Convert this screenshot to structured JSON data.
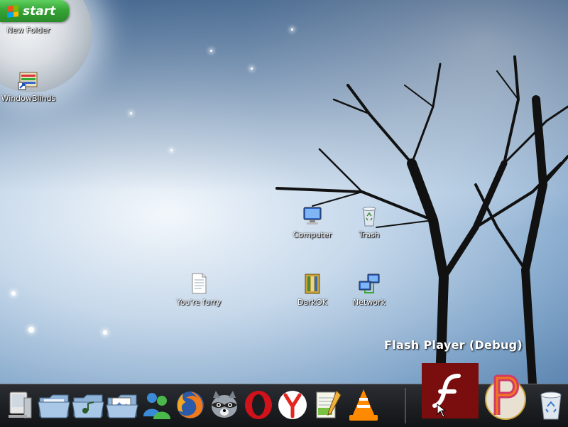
{
  "start": {
    "label": "start"
  },
  "desktop_icons": [
    {
      "id": "new-folder",
      "label": "New Folder"
    },
    {
      "id": "windowblinds",
      "label": "WindowBlinds"
    },
    {
      "id": "computer",
      "label": "Computer"
    },
    {
      "id": "trash",
      "label": "Trash"
    },
    {
      "id": "youre-furry",
      "label": "You're furry"
    },
    {
      "id": "darkok",
      "label": "DarkOK"
    },
    {
      "id": "network",
      "label": "Network"
    }
  ],
  "flash_tooltip": {
    "label": "Flash Player (Debug)"
  },
  "dock": {
    "items": [
      {
        "name": "display-monitor-icon"
      },
      {
        "name": "folder-icon"
      },
      {
        "name": "music-folder-icon"
      },
      {
        "name": "pictures-folder-icon"
      },
      {
        "name": "messenger-icon"
      },
      {
        "name": "firefox-icon"
      },
      {
        "name": "raccoon-icon"
      },
      {
        "name": "opera-icon"
      },
      {
        "name": "yandex-icon"
      },
      {
        "name": "notepad-icon"
      },
      {
        "name": "vlc-icon"
      },
      {
        "name": "flash-player-icon"
      },
      {
        "name": "p-app-icon"
      },
      {
        "name": "recycle-bin-icon"
      }
    ]
  },
  "colors": {
    "start_green": "#35a535",
    "dock_bg": "#1a1c1f",
    "flash_red": "#7a0e0e"
  }
}
